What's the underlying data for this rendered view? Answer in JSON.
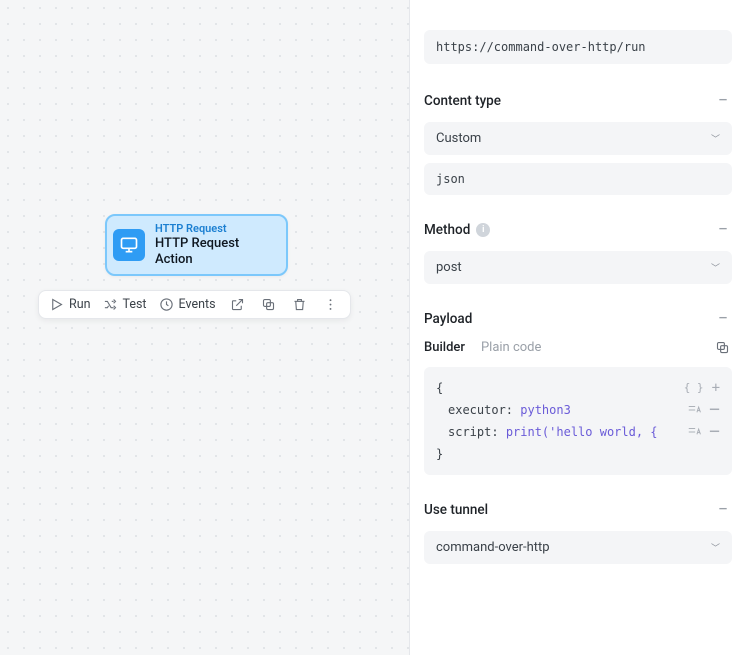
{
  "canvas": {
    "node": {
      "type_label": "HTTP Request",
      "title": "HTTP Request Action"
    },
    "toolbar": {
      "run": "Run",
      "test": "Test",
      "events": "Events"
    }
  },
  "panel": {
    "url": "https://command-over-http/run",
    "sections": {
      "content_type": {
        "title": "Content type",
        "select_value": "Custom",
        "code_value": "json"
      },
      "method": {
        "title": "Method",
        "select_value": "post"
      },
      "payload": {
        "title": "Payload",
        "tabs": {
          "builder": "Builder",
          "plain": "Plain code"
        },
        "code": {
          "open": "{",
          "line1_key": "executor",
          "line1_val": "python3",
          "line2_key": "script",
          "line2_val": "print('hello world, {",
          "close": "}"
        }
      },
      "use_tunnel": {
        "title": "Use tunnel",
        "select_value": "command-over-http"
      }
    }
  }
}
